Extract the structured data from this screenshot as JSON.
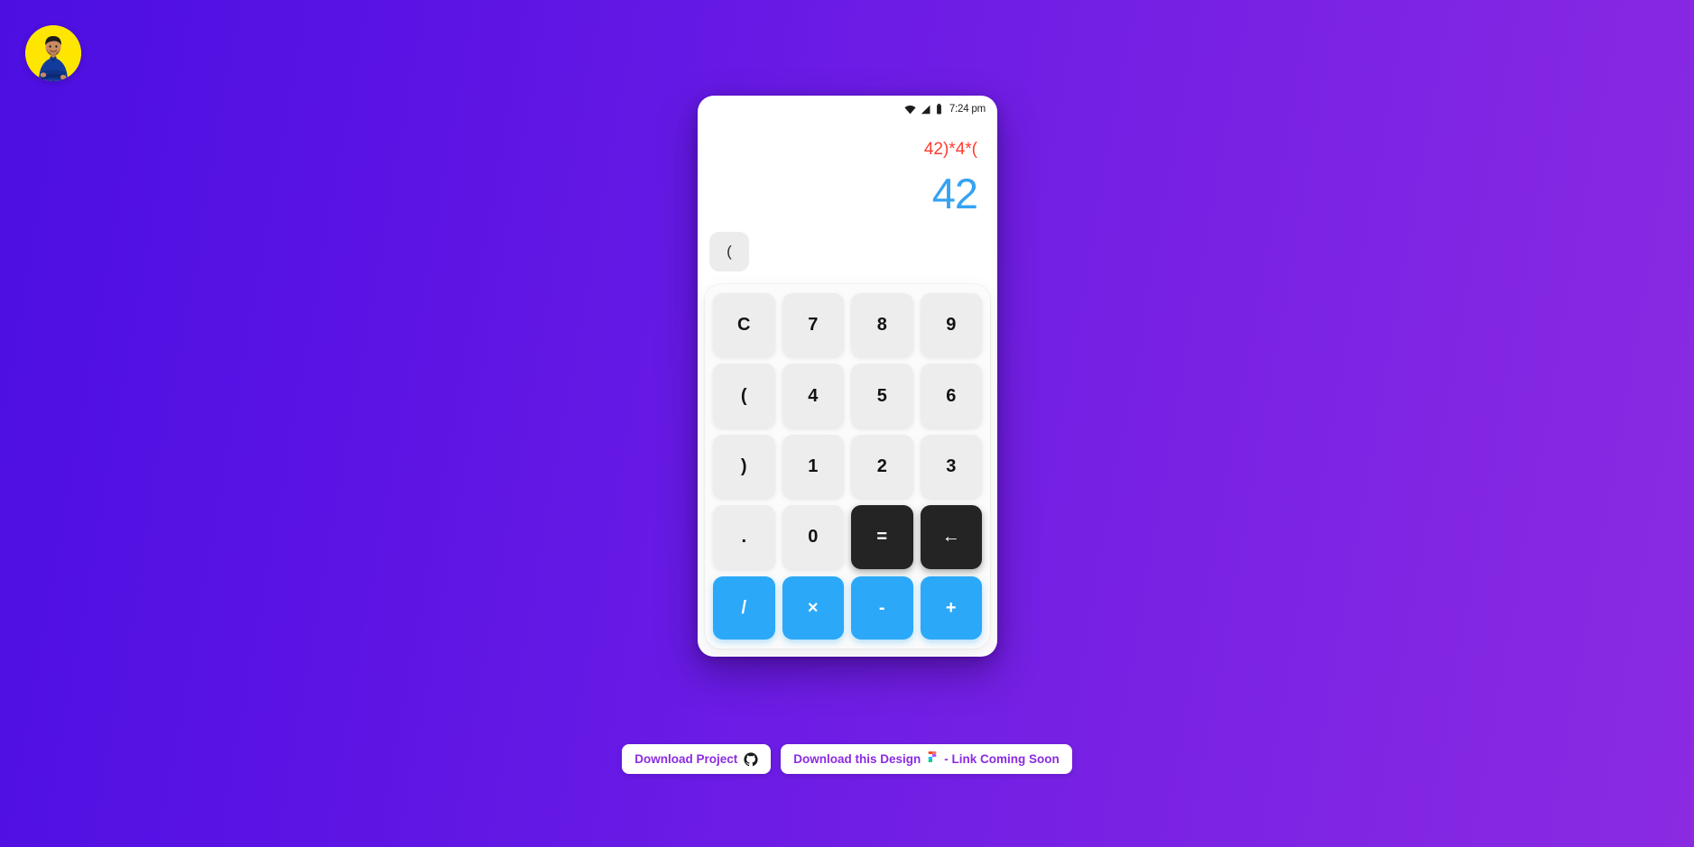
{
  "background": {
    "gradient_from": "#4C0FE2",
    "gradient_to": "#8A2BE2"
  },
  "avatar": {
    "name": "profile-avatar",
    "bg_color": "#FFE600",
    "alt": "Profile photo"
  },
  "phone": {
    "statusbar": {
      "wifi_icon": "wifi-icon",
      "signal_icon": "signal-icon",
      "battery_icon": "battery-icon",
      "time": "7:24 pm"
    },
    "display": {
      "expression": "42)*4*(",
      "expression_color": "#FF3B30",
      "result": "42",
      "result_color": "#35A3F2"
    },
    "history": {
      "chips": [
        {
          "label": "("
        }
      ]
    },
    "keypad": {
      "rows": [
        [
          {
            "label": "C",
            "type": "num",
            "name": "key-clear"
          },
          {
            "label": "7",
            "type": "num",
            "name": "key-7"
          },
          {
            "label": "8",
            "type": "num",
            "name": "key-8"
          },
          {
            "label": "9",
            "type": "num",
            "name": "key-9"
          }
        ],
        [
          {
            "label": "(",
            "type": "num",
            "name": "key-open-paren"
          },
          {
            "label": "4",
            "type": "num",
            "name": "key-4"
          },
          {
            "label": "5",
            "type": "num",
            "name": "key-5"
          },
          {
            "label": "6",
            "type": "num",
            "name": "key-6"
          }
        ],
        [
          {
            "label": ")",
            "type": "num",
            "name": "key-close-paren"
          },
          {
            "label": "1",
            "type": "num",
            "name": "key-1"
          },
          {
            "label": "2",
            "type": "num",
            "name": "key-2"
          },
          {
            "label": "3",
            "type": "num",
            "name": "key-3"
          }
        ],
        [
          {
            "label": ".",
            "type": "num",
            "name": "key-decimal"
          },
          {
            "label": "0",
            "type": "num",
            "name": "key-0"
          },
          {
            "label": "=",
            "type": "dark",
            "name": "key-equals"
          },
          {
            "label": "←",
            "type": "dark",
            "name": "key-backspace"
          }
        ],
        [
          {
            "label": "/",
            "type": "op",
            "name": "key-divide"
          },
          {
            "label": "×",
            "type": "op",
            "name": "key-multiply"
          },
          {
            "label": "-",
            "type": "op",
            "name": "key-subtract"
          },
          {
            "label": "+",
            "type": "op",
            "name": "key-add"
          }
        ]
      ],
      "colors": {
        "num_bg": "#EDEDED",
        "dark_bg": "#242424",
        "op_bg": "#2BA8F8"
      }
    }
  },
  "footer": {
    "download_project": {
      "label": "Download Project",
      "icon": "github-icon"
    },
    "download_design": {
      "label": "Download this Design",
      "icon": "figma-icon",
      "suffix": "- Link Coming Soon"
    },
    "text_color": "#8B2BE2"
  }
}
